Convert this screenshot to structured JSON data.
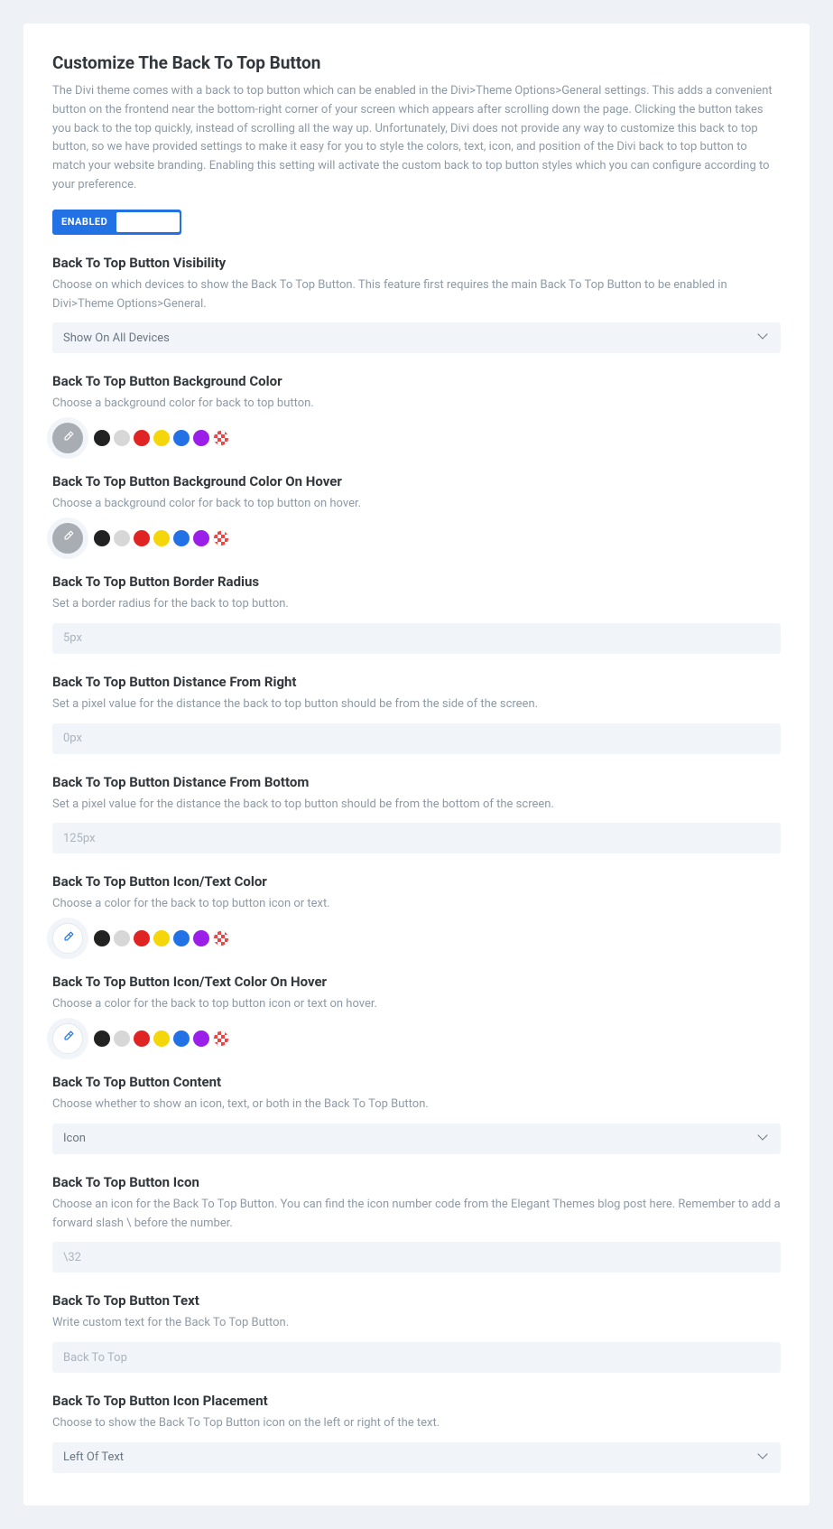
{
  "main": {
    "title": "Customize The Back To Top Button",
    "desc": "The Divi theme comes with a back to top button which can be enabled in the Divi>Theme Options>General settings. This adds a convenient button on the frontend near the bottom-right corner of your screen which appears after scrolling down the page. Clicking the button takes you back to the top quickly, instead of scrolling all the way up. Unfortunately, Divi does not provide any way to customize this back to top button, so we have provided settings to make it easy for you to style the colors, text, icon, and position of the Divi back to top button to match your website branding. Enabling this setting will activate the custom back to top button styles which you can configure according to your preference.",
    "toggle_label": "ENABLED"
  },
  "palette": [
    "#222222",
    "#d7d7d7",
    "#e02424",
    "#f5d60a",
    "#2271e5",
    "#9b1fe8"
  ],
  "sections": {
    "visibility": {
      "title": "Back To Top Button Visibility",
      "desc": "Choose on which devices to show the Back To Top Button. This feature first requires the main Back To Top Button to be enabled in Divi>Theme Options>General.",
      "value": "Show On All Devices"
    },
    "bg_color": {
      "title": "Back To Top Button Background Color",
      "desc": "Choose a background color for back to top button."
    },
    "bg_color_hover": {
      "title": "Back To Top Button Background Color On Hover",
      "desc": "Choose a background color for back to top button on hover."
    },
    "border_radius": {
      "title": "Back To Top Button Border Radius",
      "desc": "Set a border radius for the back to top button.",
      "value": "5px"
    },
    "dist_right": {
      "title": "Back To Top Button Distance From Right",
      "desc": "Set a pixel value for the distance the back to top button should be from the side of the screen.",
      "value": "0px"
    },
    "dist_bottom": {
      "title": "Back To Top Button Distance From Bottom",
      "desc": "Set a pixel value for the distance the back to top button should be from the bottom of the screen.",
      "value": "125px"
    },
    "icon_color": {
      "title": "Back To Top Button Icon/Text Color",
      "desc": "Choose a color for the back to top button icon or text."
    },
    "icon_color_hover": {
      "title": "Back To Top Button Icon/Text Color On Hover",
      "desc": "Choose a color for the back to top button icon or text on hover."
    },
    "content": {
      "title": "Back To Top Button Content",
      "desc": "Choose whether to show an icon, text, or both in the Back To Top Button.",
      "value": "Icon"
    },
    "icon": {
      "title": "Back To Top Button Icon",
      "desc": "Choose an icon for the Back To Top Button. You can find the icon number code from the Elegant Themes blog post here. Remember to add a forward slash \\ before the number.",
      "value": "\\32"
    },
    "text": {
      "title": "Back To Top Button Text",
      "desc": "Write custom text for the Back To Top Button.",
      "value": "Back To Top"
    },
    "placement": {
      "title": "Back To Top Button Icon Placement",
      "desc": "Choose to show the Back To Top Button icon on the left or right of the text.",
      "value": "Left Of Text"
    }
  }
}
